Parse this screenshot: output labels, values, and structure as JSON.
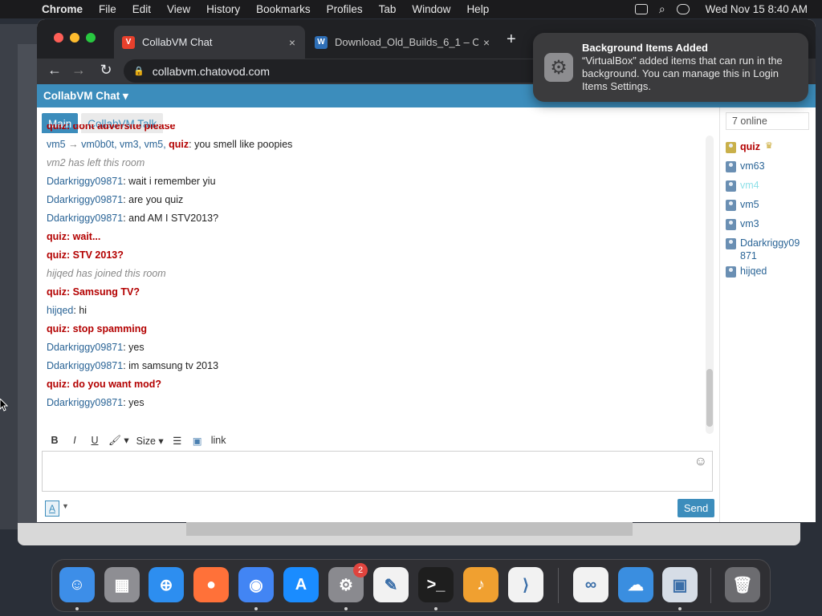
{
  "menubar": {
    "app": "Chrome",
    "items": [
      "File",
      "Edit",
      "View",
      "History",
      "Bookmarks",
      "Profiles",
      "Tab",
      "Window",
      "Help"
    ],
    "clock": "Wed Nov 15  8:40 AM"
  },
  "browser": {
    "tabs": [
      {
        "title": "CollabVM Chat",
        "close": "×"
      },
      {
        "title": "Download_Old_Builds_6_1 – O",
        "close": "×"
      }
    ],
    "new_tab": "+",
    "url": "collabvm.chatovod.com"
  },
  "chat": {
    "brand": "CollabVM Chat ▾",
    "rooms": [
      "Main",
      "CollabVM Talk"
    ],
    "messages": [
      {
        "user": "quiz",
        "sep": ": ",
        "text": "dont adversite please",
        "admin": true
      },
      {
        "rename": true,
        "from": "vm5",
        "arrow": " → ",
        "to": "vm0b0t",
        "mentions": ", vm3, vm5, ",
        "user": "quiz",
        "sep": ": ",
        "text": "you smell like poopies"
      },
      {
        "system": "vm2 has left this room"
      },
      {
        "user": "Ddarkriggy09871",
        "sep": ": ",
        "text": "wait i remember yiu"
      },
      {
        "user": "Ddarkriggy09871",
        "sep": ": ",
        "text": "are you quiz"
      },
      {
        "user": "Ddarkriggy09871",
        "sep": ": ",
        "text": "and AM I STV2013?"
      },
      {
        "user": "quiz",
        "sep": ": ",
        "text": "wait...",
        "admin": true
      },
      {
        "user": "quiz",
        "sep": ": ",
        "text": "STV 2013?",
        "admin": true
      },
      {
        "system": "hijqed has joined this room"
      },
      {
        "user": "quiz",
        "sep": ": ",
        "text": "Samsung TV?",
        "admin": true
      },
      {
        "user": "hijqed",
        "sep": ": ",
        "text": "hi"
      },
      {
        "user": "quiz",
        "sep": ": ",
        "text": "stop spamming",
        "admin": true
      },
      {
        "user": "Ddarkriggy09871",
        "sep": ": ",
        "text": "yes"
      },
      {
        "user": "Ddarkriggy09871",
        "sep": ": ",
        "text": "im samsung tv 2013"
      },
      {
        "user": "quiz",
        "sep": ": ",
        "text": "do you want mod?",
        "admin": true
      },
      {
        "user": "Ddarkriggy09871",
        "sep": ": ",
        "text": "yes"
      }
    ],
    "editor": {
      "bold": "B",
      "italic": "I",
      "underline": "U",
      "color": "🖌 ▾",
      "size": "Size ▾",
      "list": "☰",
      "image": "▣",
      "link": "link"
    },
    "format_button": "A",
    "send": "Send",
    "online": "7 online",
    "users": [
      {
        "name": "quiz",
        "admin": true,
        "crown": "♛"
      },
      {
        "name": "vm63"
      },
      {
        "name": "vm4",
        "faded": true
      },
      {
        "name": "vm5"
      },
      {
        "name": "vm3"
      },
      {
        "name": "Ddarkriggy09871"
      },
      {
        "name": "hijqed"
      }
    ]
  },
  "notification": {
    "title": "Background Items Added",
    "body": "“VirtualBox” added items that can run in the background. You can manage this in Login Items Settings."
  },
  "dock": {
    "apps": [
      {
        "name": "Finder",
        "color": "#3d8ee8",
        "glyph": "☺"
      },
      {
        "name": "Launchpad",
        "color": "#8e8e93",
        "glyph": "▦"
      },
      {
        "name": "Safari",
        "color": "#2d8ef0",
        "glyph": "⊕"
      },
      {
        "name": "Firefox",
        "color": "#ff7139",
        "glyph": "●"
      },
      {
        "name": "Chrome",
        "color": "#4285f4",
        "glyph": "◉"
      },
      {
        "name": "App Store",
        "color": "#1a8cff",
        "glyph": "A"
      },
      {
        "name": "System Settings",
        "color": "#8a8a8f",
        "glyph": "⚙"
      },
      {
        "name": "TextEdit",
        "color": "#f2f2f2",
        "glyph": "✎"
      },
      {
        "name": "Terminal",
        "color": "#1e1e1e",
        "glyph": ">_"
      },
      {
        "name": "GarageBand",
        "color": "#f0a030",
        "glyph": "♪"
      },
      {
        "name": "VS Code",
        "color": "#f2f2f2",
        "glyph": "⟩"
      },
      {
        "name": "Visual Studio",
        "color": "#f2f2f2",
        "glyph": "∞"
      },
      {
        "name": "Weather",
        "color": "#3a8ee0",
        "glyph": "☁"
      },
      {
        "name": "VirtualBox",
        "color": "#d6dde6",
        "glyph": "▣"
      },
      {
        "name": "Trash",
        "color": "#6c6c70",
        "glyph": "🗑"
      }
    ],
    "settings_badge": "2"
  }
}
